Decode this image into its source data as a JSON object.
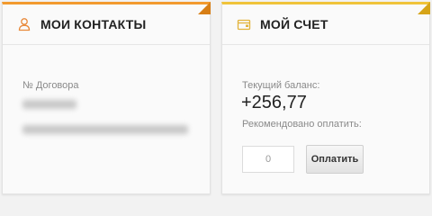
{
  "contacts": {
    "icon": "user-icon",
    "title": "МОИ КОНТАКТЫ",
    "contract_label": "№ Договора"
  },
  "account": {
    "icon": "wallet-icon",
    "title": "МОЙ СЧЕТ",
    "balance_label": "Текущий баланс:",
    "balance_value": "+256,77",
    "recommended_label": "Рекомендовано оплатить:",
    "amount_value": "0",
    "pay_label": "Оплатить"
  },
  "colors": {
    "contacts_accent": "#f29a2e",
    "account_accent": "#f0c33a"
  }
}
